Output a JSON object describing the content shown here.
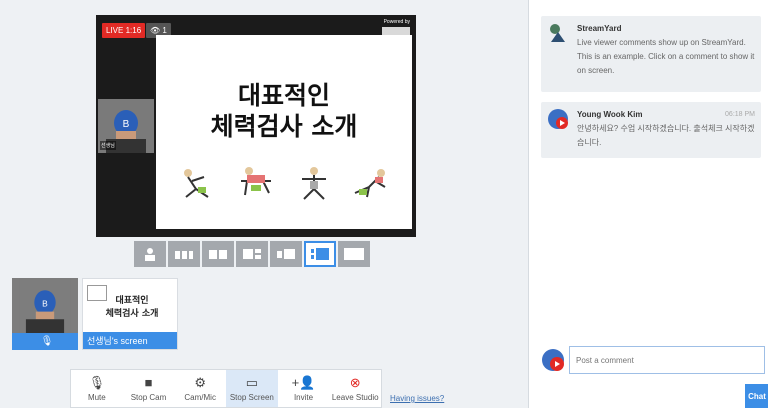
{
  "stage": {
    "live_label": "LIVE 1:16",
    "viewers": "1",
    "powered_by": "Powered by",
    "slide_title_line1": "대표적인",
    "slide_title_line2": "체력검사 소개",
    "presenter_name": "선생님"
  },
  "sources": {
    "tile1_label": "",
    "tile2_title_line1": "대표적인",
    "tile2_title_line2": "체력검사 소개",
    "tile2_label": "선생님's screen"
  },
  "toolbar": {
    "mute": "Mute",
    "stop_cam": "Stop Cam",
    "cam_mic": "Cam/Mic",
    "stop_screen": "Stop Screen",
    "invite": "Invite",
    "leave_studio": "Leave Studio",
    "having_issues": "Having issues?"
  },
  "chat": {
    "comments": [
      {
        "author": "StreamYard",
        "time": "",
        "text": "Live viewer comments show up on StreamYard. This is an example. Click on a comment to show it on screen."
      },
      {
        "author": "Young Wook Kim",
        "time": "06:18 PM",
        "text": "안녕하세요? 수업 시작하겠습니다. 출석체크 시작하겠습니다."
      }
    ],
    "input_placeholder": "Post a comment",
    "send_label": "Chat"
  },
  "colors": {
    "accent": "#3c8ee6",
    "live": "#e22a25"
  }
}
